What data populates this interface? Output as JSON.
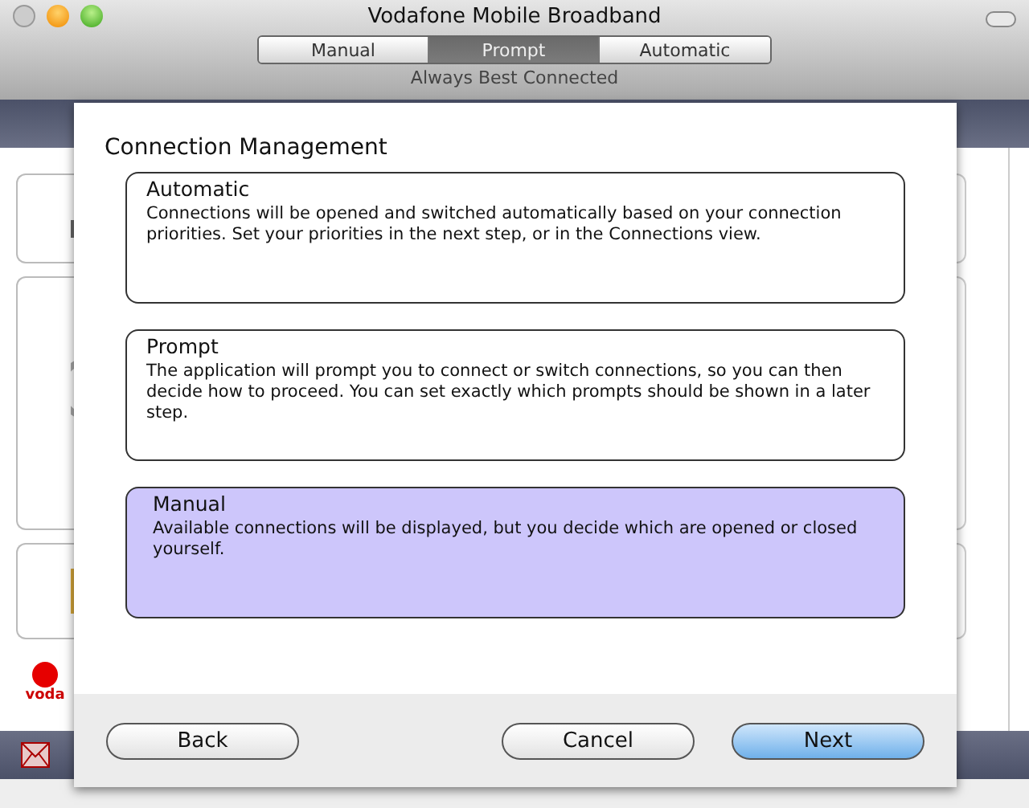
{
  "window": {
    "title": "Vodafone Mobile Broadband"
  },
  "mode_switch": [
    {
      "label": "Manual",
      "selected": false
    },
    {
      "label": "Prompt",
      "selected": true
    },
    {
      "label": "Automatic",
      "selected": false
    }
  ],
  "subtitle": "Always Best Connected",
  "logo": {
    "text": "voda"
  },
  "sheet": {
    "heading": "Connection Management",
    "options": [
      {
        "title": "Automatic",
        "description": "Connections will be opened and switched automatically based on your connection priorities. Set your priorities in the next step, or in the Connections view.",
        "selected": false
      },
      {
        "title": "Prompt",
        "description": "The application will prompt you to connect or switch connections, so you can then decide how to proceed. You can set exactly which prompts should be shown in a later step.",
        "selected": false
      },
      {
        "title": "Manual",
        "description": "Available connections will be displayed, but you decide which are opened or closed yourself.",
        "selected": true
      }
    ],
    "buttons": [
      {
        "label": "Back",
        "default": false
      },
      {
        "label": "Cancel",
        "default": false
      },
      {
        "label": "Next",
        "default": true
      }
    ]
  }
}
